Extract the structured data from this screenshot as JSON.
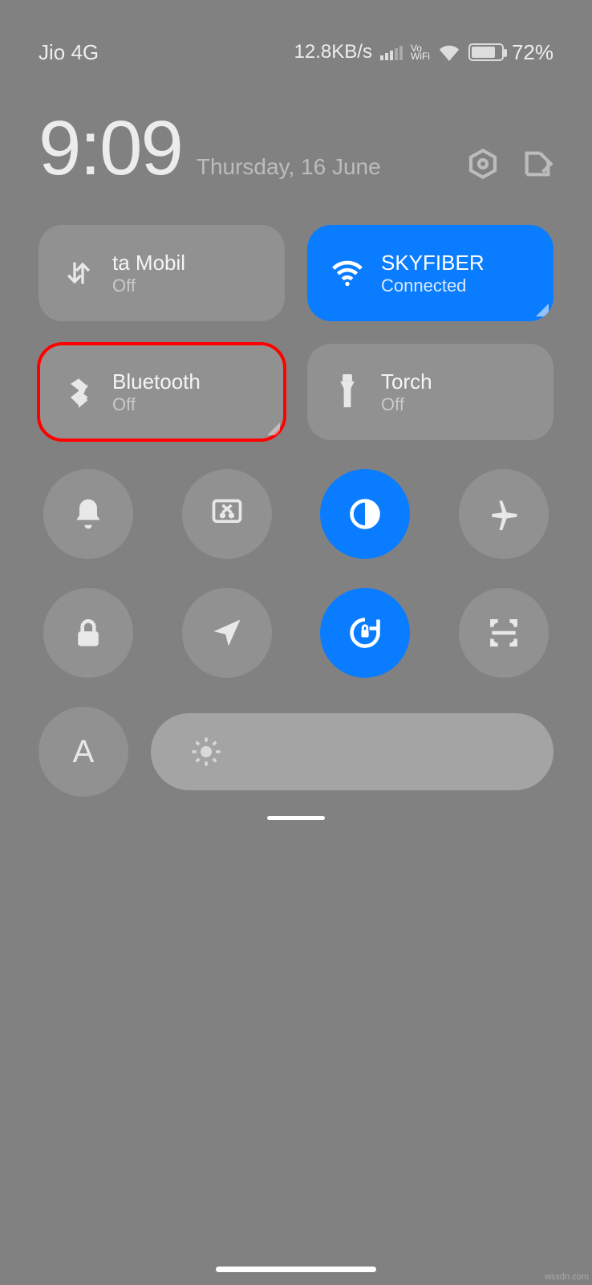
{
  "status": {
    "carrier": "Jio 4G",
    "speed": "12.8KB/s",
    "vowifi_top": "Vo",
    "vowifi_bot": "WiFi",
    "battery": "72%",
    "battery_small": "%"
  },
  "clock": {
    "time": "9:09",
    "date": "Thursday, 16 June"
  },
  "tiles": {
    "data": {
      "title": "ta    Mobil",
      "sub": "Off"
    },
    "wifi": {
      "title": "SKYFIBER",
      "sub": "Connected"
    },
    "bt": {
      "title": "Bluetooth",
      "sub": "Off"
    },
    "torch": {
      "title": "Torch",
      "sub": "Off"
    }
  },
  "brightness": {
    "auto_label": "A"
  },
  "watermark": "wsxdn.com"
}
